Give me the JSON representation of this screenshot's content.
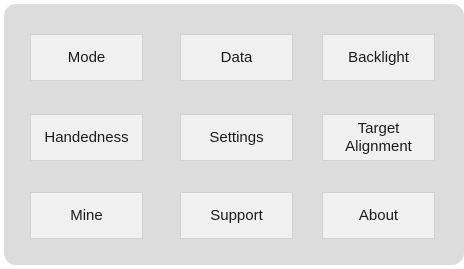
{
  "menu": {
    "mode_label": "Mode",
    "data_label": "Data",
    "backlight_label": "Backlight",
    "handedness_label": "Handedness",
    "settings_label": "Settings",
    "target_alignment_label": "Target Alignment",
    "mine_label": "Mine",
    "support_label": "Support",
    "about_label": "About"
  }
}
